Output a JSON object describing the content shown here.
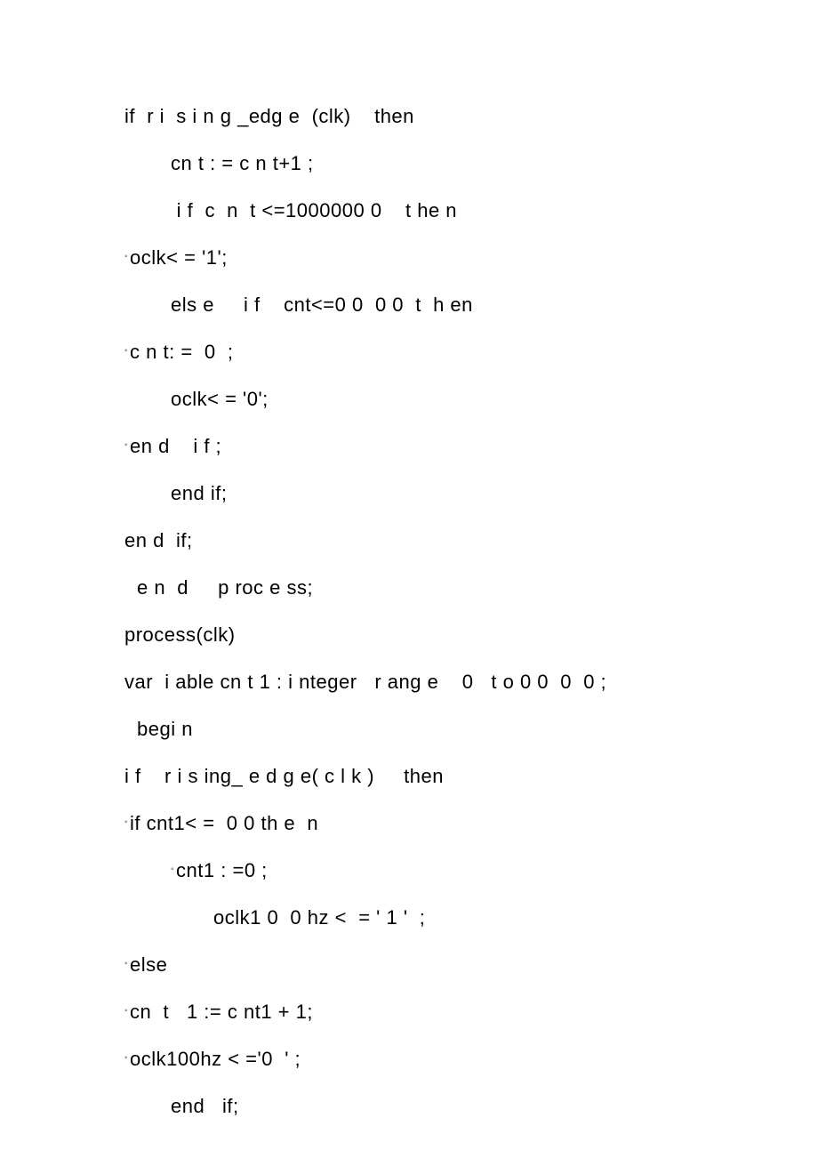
{
  "lines": [
    {
      "text": "if  r i  s i n g _edg e  (clk)    then",
      "cls": ""
    },
    {
      "text": "cn t : = c n t+1 ;",
      "cls": "indent1"
    },
    {
      "text": " i f  c  n  t <=1000000 0    t he n",
      "cls": "indent1"
    },
    {
      "text": "oclk< = '1';",
      "cls": "",
      "bullet": true
    },
    {
      "text": "els e     i f    cnt<=0 0  0 0  t  h en",
      "cls": "indent1"
    },
    {
      "text": "c n t: =  0  ;",
      "cls": "",
      "bullet": true
    },
    {
      "text": "oclk< = '0';",
      "cls": "indent1"
    },
    {
      "text": "en d    i f ;",
      "cls": "",
      "bullet": true
    },
    {
      "text": "end if;",
      "cls": "indent1"
    },
    {
      "text": "en d  if;",
      "cls": ""
    },
    {
      "text": "e n  d     p roc e ss;",
      "cls": "sp1"
    },
    {
      "text": "process(clk)",
      "cls": ""
    },
    {
      "text": "var  i able cn t 1 : i nteger   r ang e    0   t o 0 0  0  0 ;",
      "cls": ""
    },
    {
      "text": "begi n",
      "cls": "sp1"
    },
    {
      "text": "i f    r i s ing_ e d g e( c l k )     then",
      "cls": ""
    },
    {
      "text": "if cnt1< =  0 0 th e  n",
      "cls": "",
      "bullet": true
    },
    {
      "text": "cnt1 : =0 ;",
      "cls": "indent1",
      "bullet": true
    },
    {
      "text": "oclk1 0  0 hz <  = ' 1 '  ;",
      "cls": "indent2"
    },
    {
      "text": "else",
      "cls": "",
      "bullet": true
    },
    {
      "text": "cn  t   1 := c nt1 + 1;",
      "cls": "",
      "bullet": true
    },
    {
      "text": "oclk100hz < ='0  ' ;",
      "cls": "",
      "bullet": true
    },
    {
      "text": "end   if;",
      "cls": "indent1"
    }
  ]
}
